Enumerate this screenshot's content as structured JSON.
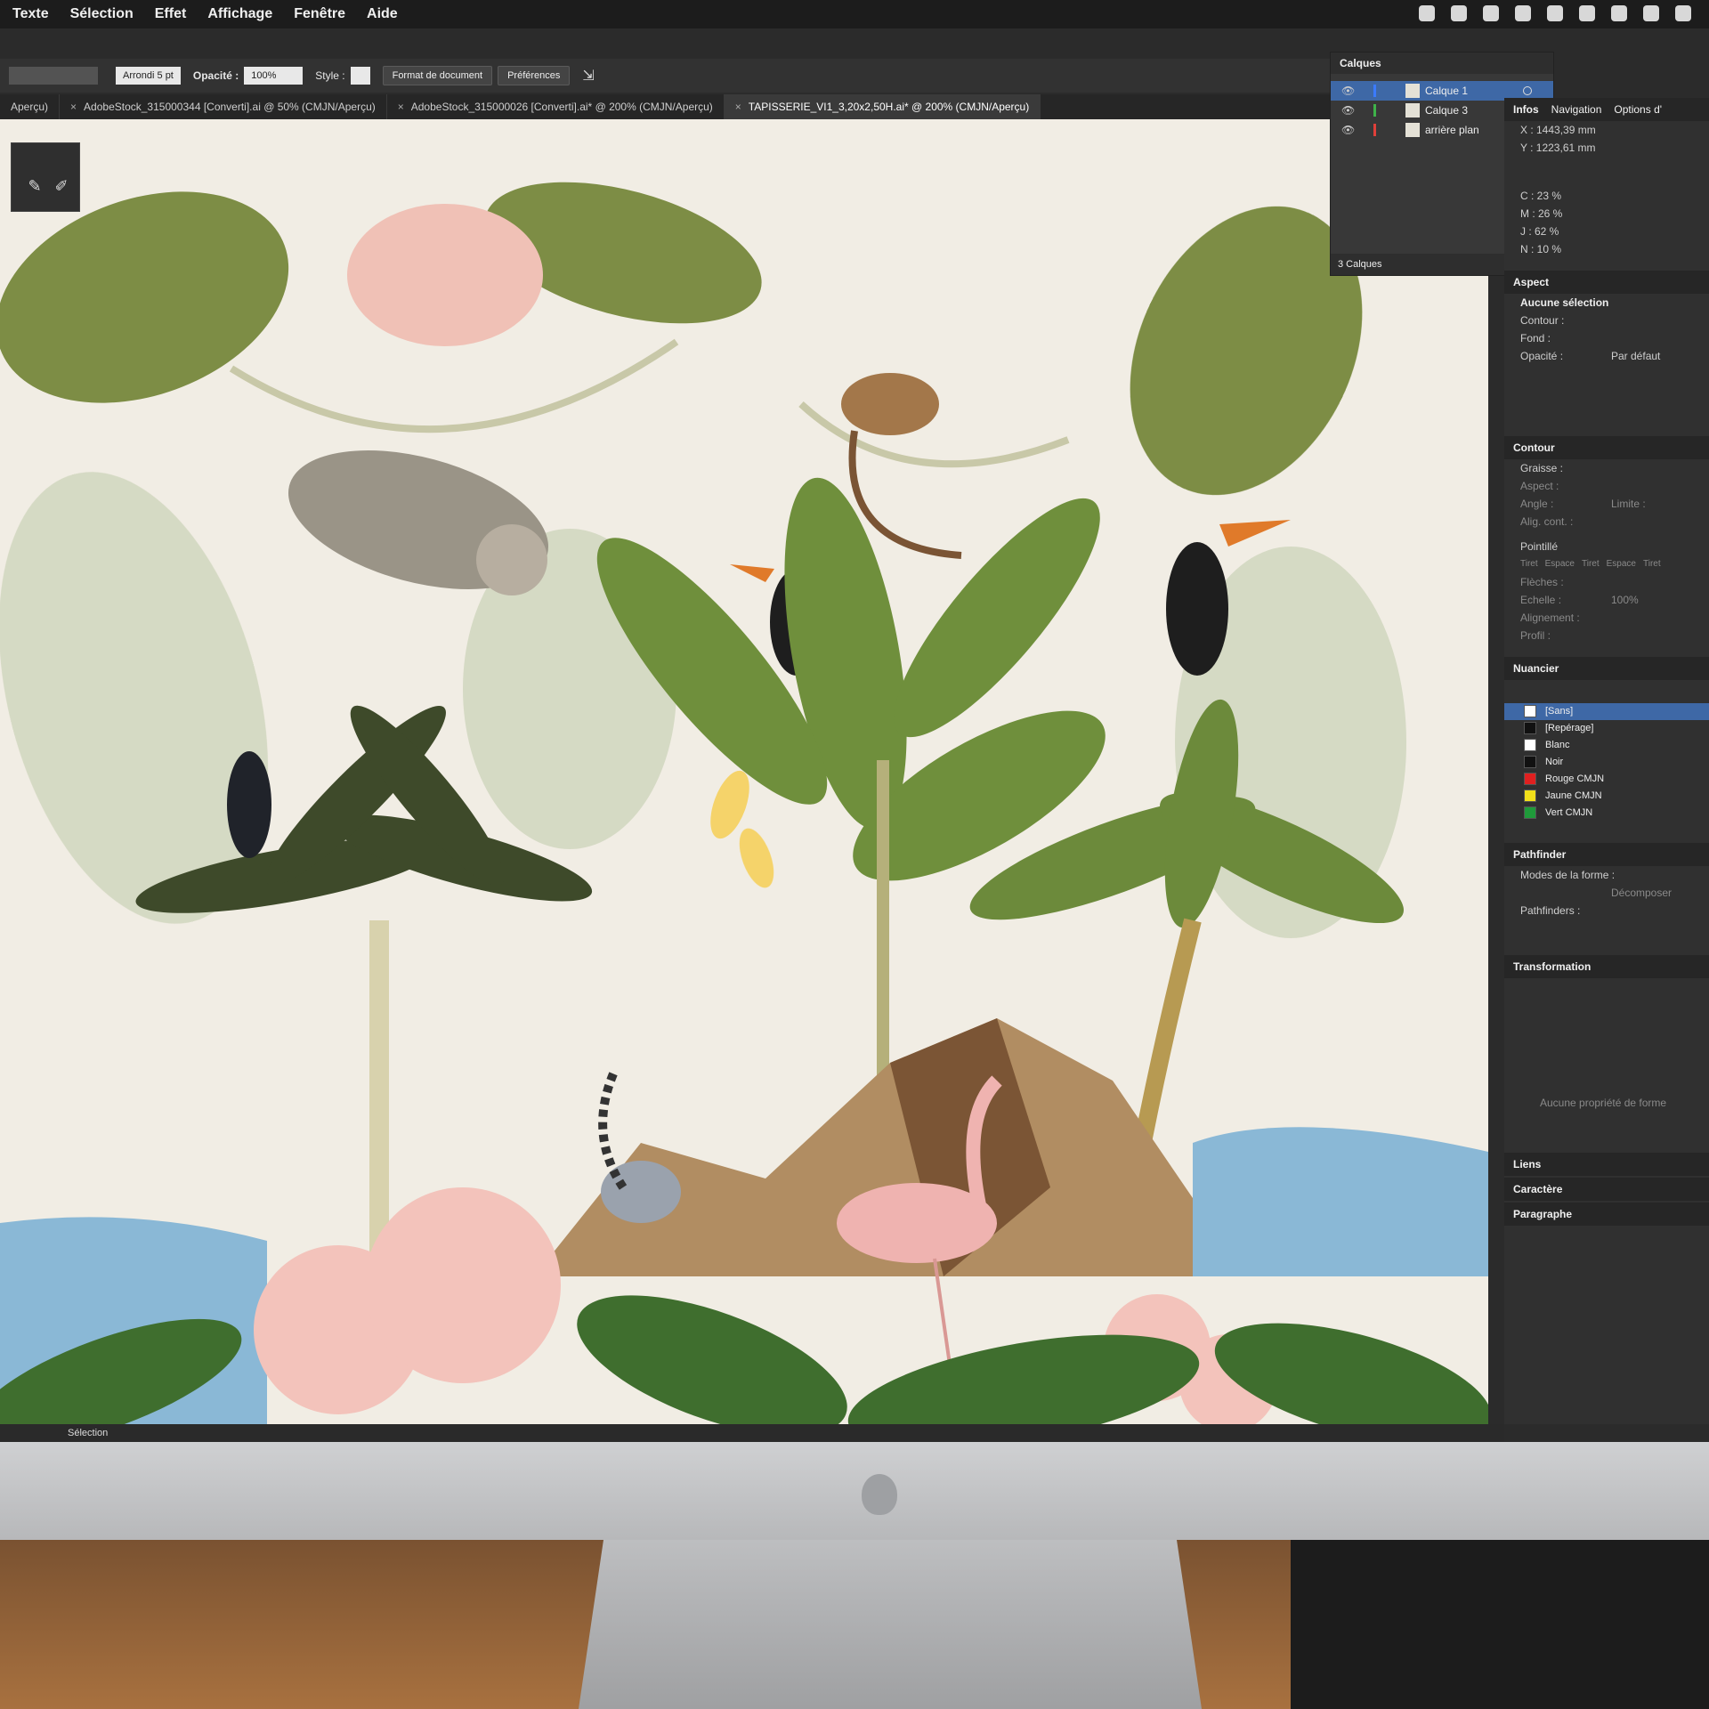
{
  "menubar": {
    "items": [
      "Texte",
      "Sélection",
      "Effet",
      "Affichage",
      "Fenêtre",
      "Aide"
    ]
  },
  "control_bar": {
    "brush": "Arrondi 5 pt",
    "opacity_label": "Opacité :",
    "opacity_value": "100%",
    "style_label": "Style :",
    "doc_format_button": "Format de document",
    "preferences_button": "Préférences"
  },
  "tabs": [
    {
      "label": "Aperçu)",
      "active": false
    },
    {
      "label": "AdobeStock_315000344 [Converti].ai @ 50% (CMJN/Aperçu)",
      "active": false
    },
    {
      "label": "AdobeStock_315000026 [Converti].ai* @ 200% (CMJN/Aperçu)",
      "active": false
    },
    {
      "label": "TAPISSERIE_VI1_3,20x2,50H.ai* @ 200% (CMJN/Aperçu)",
      "active": true
    }
  ],
  "layers_panel": {
    "title": "Calques",
    "layers": [
      {
        "name": "Calque 1",
        "color": "#3b7bff",
        "selected": true
      },
      {
        "name": "Calque 3",
        "color": "#3fb24a",
        "selected": false
      },
      {
        "name": "arrière plan",
        "color": "#e0403a",
        "selected": false
      }
    ],
    "footer": "3 Calques"
  },
  "info_panel": {
    "tabs": [
      "Infos",
      "Navigation",
      "Options d'"
    ],
    "x": "X : 1443,39 mm",
    "y": "Y : 1223,61 mm",
    "c": "C : 23 %",
    "m": "M : 26 %",
    "j": "J : 62 %",
    "n": "N : 10 %"
  },
  "aspect_panel": {
    "title": "Aspect",
    "selection": "Aucune sélection",
    "contour": "Contour :",
    "fond": "Fond :",
    "opacite": "Opacité :",
    "opacite_value": "Par défaut"
  },
  "contour_panel": {
    "title": "Contour",
    "graisse": "Graisse :",
    "aspect": "Aspect :",
    "angle": "Angle :",
    "limite": "Limite :",
    "alig": "Alig. cont. :",
    "pointille": "Pointillé",
    "dash_labels": [
      "Tiret",
      "Espace",
      "Tiret",
      "Espace",
      "Tiret"
    ],
    "fleches": "Flèches :",
    "echelle": "Echelle :",
    "echelle_value": "100%",
    "alignement": "Alignement :",
    "profil": "Profil :"
  },
  "swatches_panel": {
    "title": "Nuancier",
    "items": [
      {
        "name": "[Sans]",
        "color": "#ffffff",
        "selected": true
      },
      {
        "name": "[Repérage]",
        "color": "#111111",
        "selected": false
      },
      {
        "name": "Blanc",
        "color": "#ffffff",
        "selected": false
      },
      {
        "name": "Noir",
        "color": "#111111",
        "selected": false
      },
      {
        "name": "Rouge CMJN",
        "color": "#e02020",
        "selected": false
      },
      {
        "name": "Jaune CMJN",
        "color": "#f2e01a",
        "selected": false
      },
      {
        "name": "Vert CMJN",
        "color": "#1f9a3a",
        "selected": false
      }
    ]
  },
  "pathfinder_panel": {
    "title": "Pathfinder",
    "modes": "Modes de la forme :",
    "decomposer": "Décomposer",
    "pathfinders": "Pathfinders :"
  },
  "transform_panel": {
    "title": "Transformation",
    "empty": "Aucune propriété de forme"
  },
  "collapsed_panels": [
    "Liens",
    "Caractère",
    "Paragraphe"
  ],
  "status_bar": {
    "tool": "Sélection"
  }
}
